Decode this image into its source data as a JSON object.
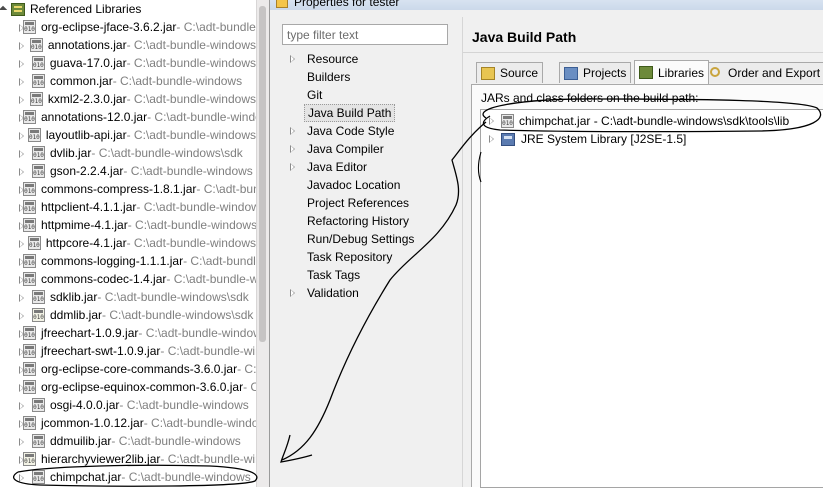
{
  "tree": {
    "root_label": "Referenced Libraries",
    "items": [
      {
        "name": "org-eclipse-jface-3.6.2.jar",
        "path": " - C:\\adt-bundle-windows"
      },
      {
        "name": "annotations.jar",
        "path": " - C:\\adt-bundle-windows"
      },
      {
        "name": "guava-17.0.jar",
        "path": " - C:\\adt-bundle-windows"
      },
      {
        "name": "common.jar",
        "path": " - C:\\adt-bundle-windows"
      },
      {
        "name": "kxml2-2.3.0.jar",
        "path": " - C:\\adt-bundle-windows"
      },
      {
        "name": "annotations-12.0.jar",
        "path": " - C:\\adt-bundle-windows"
      },
      {
        "name": "layoutlib-api.jar",
        "path": " - C:\\adt-bundle-windows"
      },
      {
        "name": "dvlib.jar",
        "path": " - C:\\adt-bundle-windows\\sdk"
      },
      {
        "name": "gson-2.2.4.jar",
        "path": " - C:\\adt-bundle-windows"
      },
      {
        "name": "commons-compress-1.8.1.jar",
        "path": " - C:\\adt-bundle-windows"
      },
      {
        "name": "httpclient-4.1.1.jar",
        "path": " - C:\\adt-bundle-windows"
      },
      {
        "name": "httpmime-4.1.jar",
        "path": " - C:\\adt-bundle-windows"
      },
      {
        "name": "httpcore-4.1.jar",
        "path": " - C:\\adt-bundle-windows"
      },
      {
        "name": "commons-logging-1.1.1.jar",
        "path": " - C:\\adt-bundle-windows"
      },
      {
        "name": "commons-codec-1.4.jar",
        "path": " - C:\\adt-bundle-windows"
      },
      {
        "name": "sdklib.jar",
        "path": " - C:\\adt-bundle-windows\\sdk"
      },
      {
        "name": "ddmlib.jar",
        "path": " - C:\\adt-bundle-windows\\sdk"
      },
      {
        "name": "jfreechart-1.0.9.jar",
        "path": " - C:\\adt-bundle-windows"
      },
      {
        "name": "jfreechart-swt-1.0.9.jar",
        "path": " - C:\\adt-bundle-windows"
      },
      {
        "name": "org-eclipse-core-commands-3.6.0.jar",
        "path": " - C:\\adt-bundle-windows"
      },
      {
        "name": "org-eclipse-equinox-common-3.6.0.jar",
        "path": " - C:\\adt-bundle-windows"
      },
      {
        "name": "osgi-4.0.0.jar",
        "path": " - C:\\adt-bundle-windows"
      },
      {
        "name": "jcommon-1.0.12.jar",
        "path": " - C:\\adt-bundle-windows"
      },
      {
        "name": "ddmuilib.jar",
        "path": " - C:\\adt-bundle-windows"
      },
      {
        "name": "hierarchyviewer2lib.jar",
        "path": " - C:\\adt-bundle-windows"
      },
      {
        "name": "chimpchat.jar",
        "path": " - C:\\adt-bundle-windows"
      }
    ]
  },
  "dialog": {
    "title": "Properties for tester",
    "filter_placeholder": "type filter text",
    "nav": [
      {
        "label": "Resource",
        "expandable": true
      },
      {
        "label": "Builders",
        "expandable": false
      },
      {
        "label": "Git",
        "expandable": false
      },
      {
        "label": "Java Build Path",
        "expandable": false,
        "selected": true
      },
      {
        "label": "Java Code Style",
        "expandable": true
      },
      {
        "label": "Java Compiler",
        "expandable": true
      },
      {
        "label": "Java Editor",
        "expandable": true
      },
      {
        "label": "Javadoc Location",
        "expandable": false
      },
      {
        "label": "Project References",
        "expandable": false
      },
      {
        "label": "Refactoring History",
        "expandable": false
      },
      {
        "label": "Run/Debug Settings",
        "expandable": false
      },
      {
        "label": "Task Repository",
        "expandable": false
      },
      {
        "label": "Task Tags",
        "expandable": false
      },
      {
        "label": "Validation",
        "expandable": true
      }
    ],
    "page_title": "Java Build Path",
    "tabs": [
      {
        "label": "Source",
        "icon": "source-folder-icon"
      },
      {
        "label": "Projects",
        "icon": "projects-icon"
      },
      {
        "label": "Libraries",
        "icon": "libraries-icon",
        "active": true
      },
      {
        "label": "Order and Export",
        "icon": "order-export-icon"
      }
    ],
    "jars_label": "JARs and class folders on the build path:",
    "libraries": [
      {
        "text": "chimpchat.jar - C:\\adt-bundle-windows\\sdk\\tools\\lib",
        "icon": "jar-icon"
      },
      {
        "text": "JRE System Library [J2SE-1.5]",
        "icon": "jre-library-icon"
      }
    ]
  },
  "colors": {
    "path_text": "#7f7f7f",
    "dialog_bg": "#f0f0f0",
    "ink": "#000000"
  }
}
